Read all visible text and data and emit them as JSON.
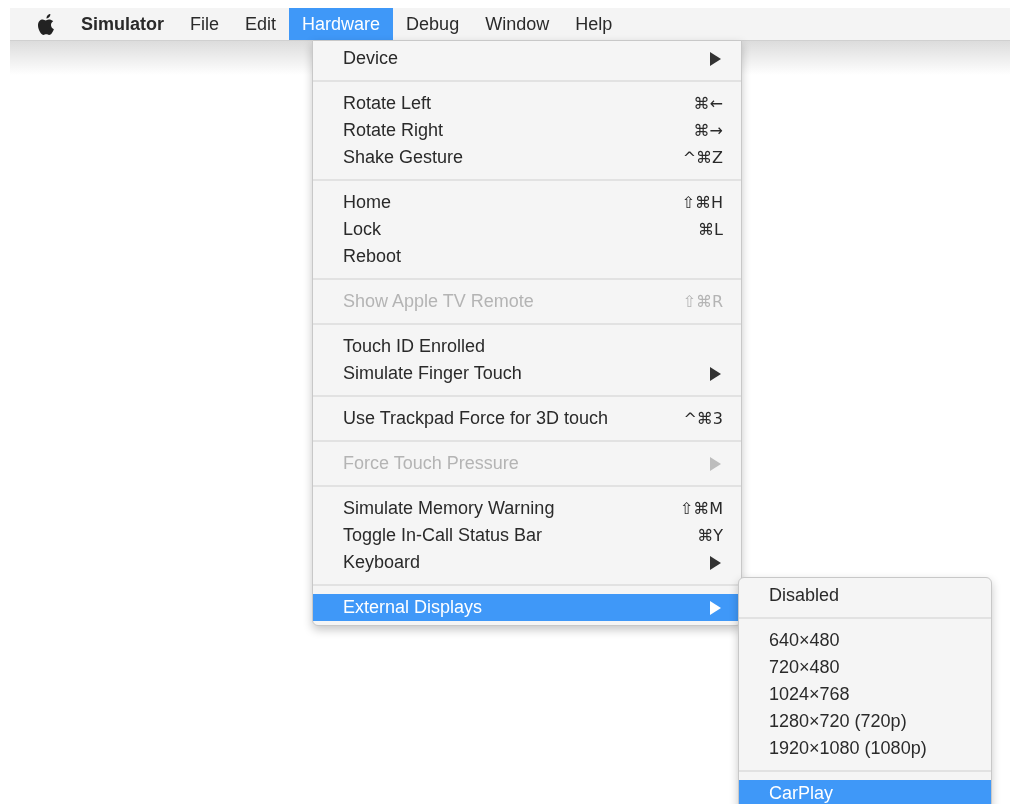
{
  "menu_bar": {
    "app_name": "Simulator",
    "items": [
      {
        "label": "File",
        "selected": false
      },
      {
        "label": "Edit",
        "selected": false
      },
      {
        "label": "Hardware",
        "selected": true
      },
      {
        "label": "Debug",
        "selected": false
      },
      {
        "label": "Window",
        "selected": false
      },
      {
        "label": "Help",
        "selected": false
      }
    ]
  },
  "hardware_menu": {
    "groups": [
      [
        {
          "label": "Device",
          "submenu": true,
          "disabled": false,
          "selected": false
        }
      ],
      [
        {
          "label": "Rotate Left",
          "shortcut": "⌘←",
          "submenu": false,
          "disabled": false,
          "selected": false
        },
        {
          "label": "Rotate Right",
          "shortcut": "⌘→",
          "submenu": false,
          "disabled": false,
          "selected": false
        },
        {
          "label": "Shake Gesture",
          "shortcut": "^⌘Z",
          "submenu": false,
          "disabled": false,
          "selected": false
        }
      ],
      [
        {
          "label": "Home",
          "shortcut": "⇧⌘H",
          "submenu": false,
          "disabled": false,
          "selected": false
        },
        {
          "label": "Lock",
          "shortcut": "⌘L",
          "submenu": false,
          "disabled": false,
          "selected": false
        },
        {
          "label": "Reboot",
          "submenu": false,
          "disabled": false,
          "selected": false
        }
      ],
      [
        {
          "label": "Show Apple TV Remote",
          "shortcut": "⇧⌘R",
          "submenu": false,
          "disabled": true,
          "selected": false
        }
      ],
      [
        {
          "label": "Touch ID Enrolled",
          "submenu": false,
          "disabled": false,
          "selected": false
        },
        {
          "label": "Simulate Finger Touch",
          "submenu": true,
          "disabled": false,
          "selected": false
        }
      ],
      [
        {
          "label": "Use Trackpad Force for 3D touch",
          "shortcut": "^⌘3",
          "submenu": false,
          "disabled": false,
          "selected": false
        }
      ],
      [
        {
          "label": "Force Touch Pressure",
          "submenu": true,
          "disabled": true,
          "selected": false
        }
      ],
      [
        {
          "label": "Simulate Memory Warning",
          "shortcut": "⇧⌘M",
          "submenu": false,
          "disabled": false,
          "selected": false
        },
        {
          "label": "Toggle In-Call Status Bar",
          "shortcut": "⌘Y",
          "submenu": false,
          "disabled": false,
          "selected": false
        },
        {
          "label": "Keyboard",
          "submenu": true,
          "disabled": false,
          "selected": false
        }
      ],
      [
        {
          "label": "External Displays",
          "submenu": true,
          "disabled": false,
          "selected": true
        }
      ]
    ]
  },
  "external_displays_submenu": {
    "groups": [
      [
        {
          "label": "Disabled",
          "selected": false
        }
      ],
      [
        {
          "label": "640×480",
          "selected": false
        },
        {
          "label": "720×480",
          "selected": false
        },
        {
          "label": "1024×768",
          "selected": false
        },
        {
          "label": "1280×720 (720p)",
          "selected": false
        },
        {
          "label": "1920×1080 (1080p)",
          "selected": false
        }
      ],
      [
        {
          "label": "CarPlay",
          "selected": true
        }
      ]
    ]
  }
}
